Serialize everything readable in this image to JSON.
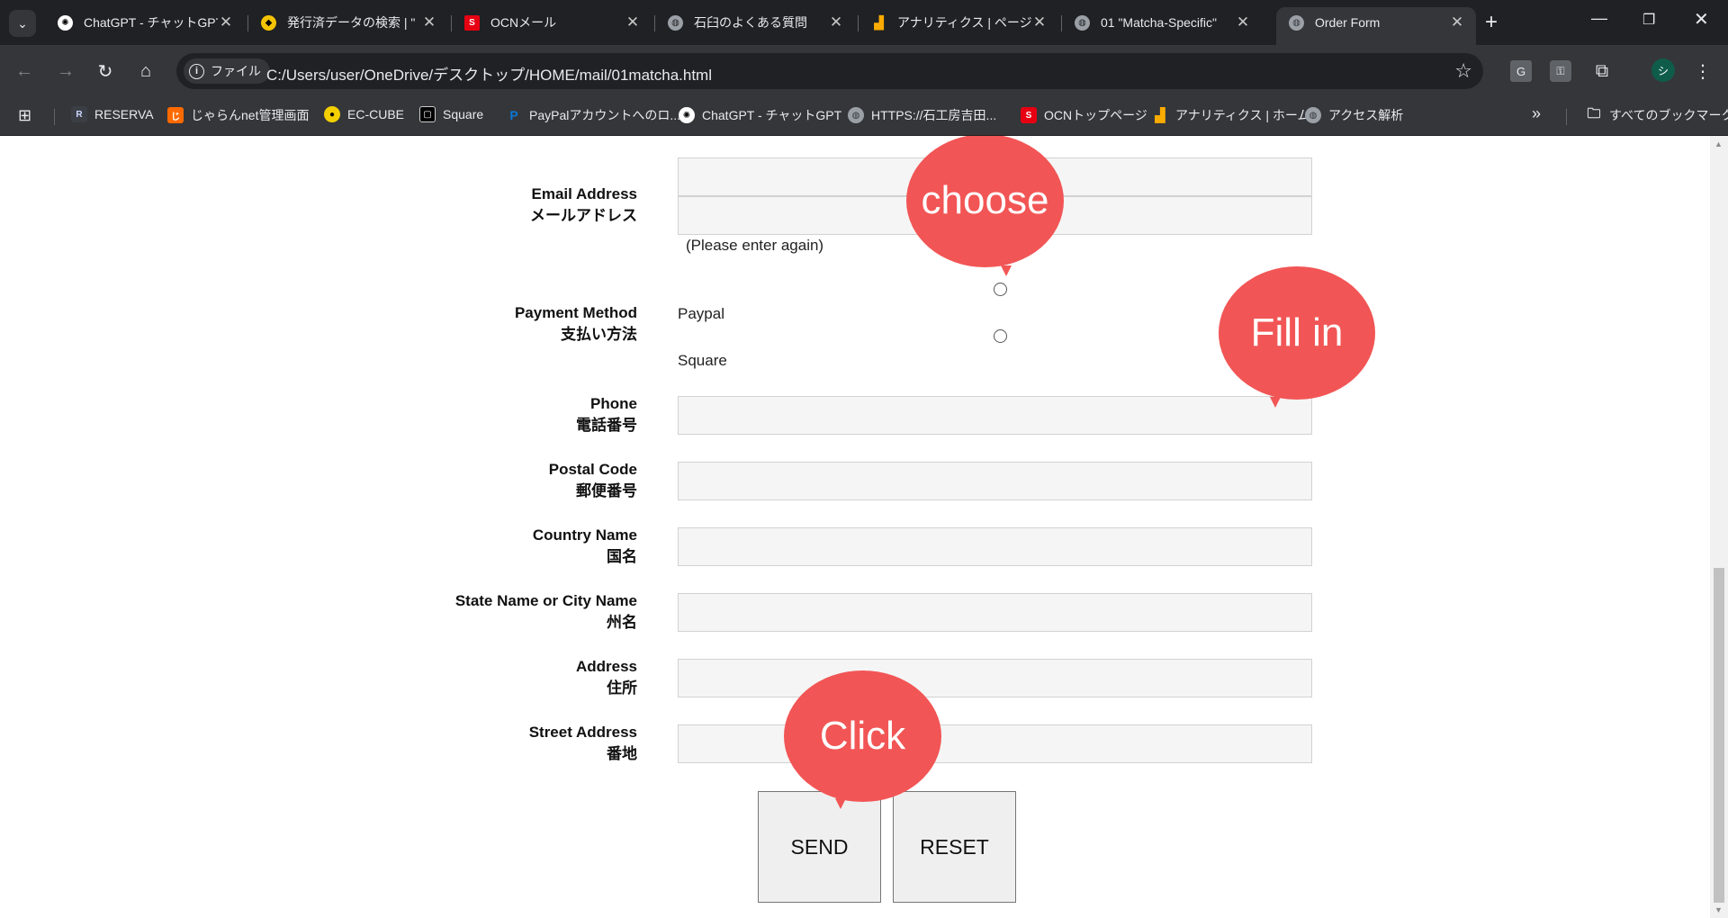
{
  "tabs": [
    {
      "title": "ChatGPT - チャットGPT",
      "icon": "chatgpt-icon"
    },
    {
      "title": "発行済データの検索 | \"",
      "icon": "yamato-icon"
    },
    {
      "title": "OCNメール",
      "icon": "ocn-icon"
    },
    {
      "title": "石臼のよくある質問",
      "icon": "globe-icon"
    },
    {
      "title": "アナリティクス | ページと",
      "icon": "analytics-icon"
    },
    {
      "title": "01 \"Matcha-Specific\"",
      "icon": "globe-icon"
    },
    {
      "title": "Order Form",
      "icon": "globe-icon",
      "active": true
    }
  ],
  "omnibox": {
    "chip": "ファイル",
    "url": "C:/Users/user/OneDrive/デスクトップ/HOME/mail/01matcha.html"
  },
  "bookmarks": [
    {
      "label": "RESERVA"
    },
    {
      "label": "じゃらんnet管理画面"
    },
    {
      "label": "EC-CUBE"
    },
    {
      "label": "Square"
    },
    {
      "label": "PayPalアカウントへのロ..."
    },
    {
      "label": "ChatGPT - チャットGPT"
    },
    {
      "label": "HTTPS://石工房吉田..."
    },
    {
      "label": "OCNトップページ"
    },
    {
      "label": "アナリティクス | ホーム"
    },
    {
      "label": "アクセス解析"
    }
  ],
  "bookmarks_all": "すべてのブックマーク",
  "form": {
    "email": {
      "en": "Email Address",
      "ja": "メールアドレス",
      "note": "(Please enter again)"
    },
    "payment": {
      "en": "Payment Method",
      "ja": "支払い方法",
      "options": [
        "Paypal",
        "Square"
      ]
    },
    "phone": {
      "en": "Phone",
      "ja": "電話番号"
    },
    "postal": {
      "en": "Postal Code",
      "ja": "郵便番号"
    },
    "country": {
      "en": "Country Name",
      "ja": "国名"
    },
    "state": {
      "en": "State Name or City Name",
      "ja": "州名"
    },
    "address": {
      "en": "Address",
      "ja": "住所"
    },
    "street": {
      "en": "Street Address",
      "ja": "番地"
    },
    "send": "SEND",
    "reset": "RESET"
  },
  "callouts": {
    "choose": "choose",
    "fill": "Fill in",
    "click": "Click"
  },
  "colors": {
    "callout": "#f25555",
    "chrome_dark": "#202124",
    "chrome_toolbar": "#35363a"
  }
}
